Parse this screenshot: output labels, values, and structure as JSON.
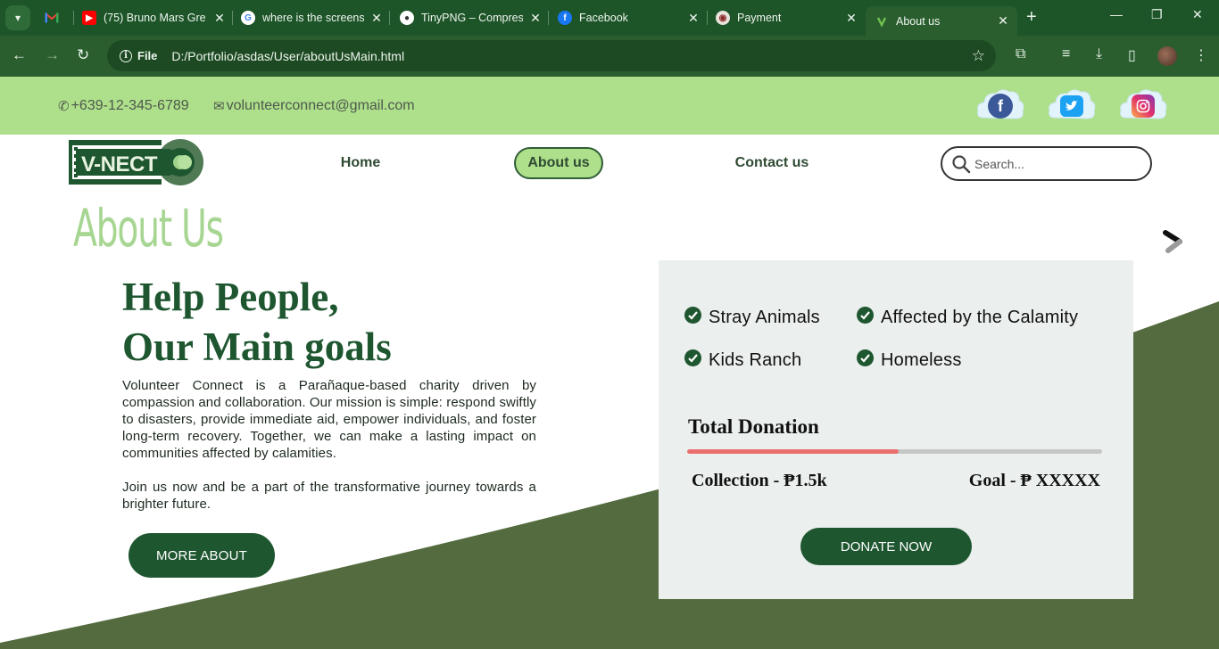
{
  "browser": {
    "tabs": [
      {
        "title": "",
        "icon": "gmail-icon"
      },
      {
        "title": "(75) Bruno Mars Gre",
        "icon": "youtube-icon"
      },
      {
        "title": "where is the screens",
        "icon": "google-icon"
      },
      {
        "title": "TinyPNG – Compres",
        "icon": "tinypng-icon"
      },
      {
        "title": "Facebook",
        "icon": "facebook-icon"
      },
      {
        "title": "Payment",
        "icon": "payment-icon"
      },
      {
        "title": "About us",
        "icon": "vnect-icon",
        "active": true
      }
    ],
    "address": {
      "chip": "File",
      "url": "D:/Portfolio/asdas/User/aboutUsMain.html"
    }
  },
  "topbar": {
    "phone": "+639-12-345-6789",
    "email": "volunteerconnect@gmail.com",
    "socials": [
      "facebook",
      "twitter",
      "instagram"
    ]
  },
  "nav": {
    "logo_text": "V-NECT",
    "links": [
      "Home",
      "About us",
      "Contact us"
    ],
    "active": "About us",
    "search_placeholder": "Search..."
  },
  "page": {
    "title": "About Us",
    "heading_line1": "Help People,",
    "heading_line2": "Our Main goals",
    "para1": "Volunteer Connect is a Parañaque-based charity driven by compassion and collaboration. Our mission is simple: respond swiftly to disasters, provide immediate aid, empower individuals, and foster long-term recovery. Together, we can make a lasting impact on communities affected by calamities.",
    "para2": "Join us now and be a part of the transformative journey towards a brighter future.",
    "more_button": "MORE ABOUT"
  },
  "card": {
    "goals": [
      "Stray Animals",
      "Affected by the Calamity",
      "Kids Ranch",
      "Homeless"
    ],
    "total_title": "Total Donation",
    "progress_fraction": 0.51,
    "collection": "Collection - ₱1.5k",
    "goal": "Goal - ₱ XXXXX",
    "donate_button": "DONATE NOW"
  },
  "colors": {
    "browser_dark": "#1d5428",
    "brand_green": "#1e5630",
    "light_green": "#aedf8a",
    "wave_green": "#546b3f",
    "progress": "#ec6f6f"
  }
}
